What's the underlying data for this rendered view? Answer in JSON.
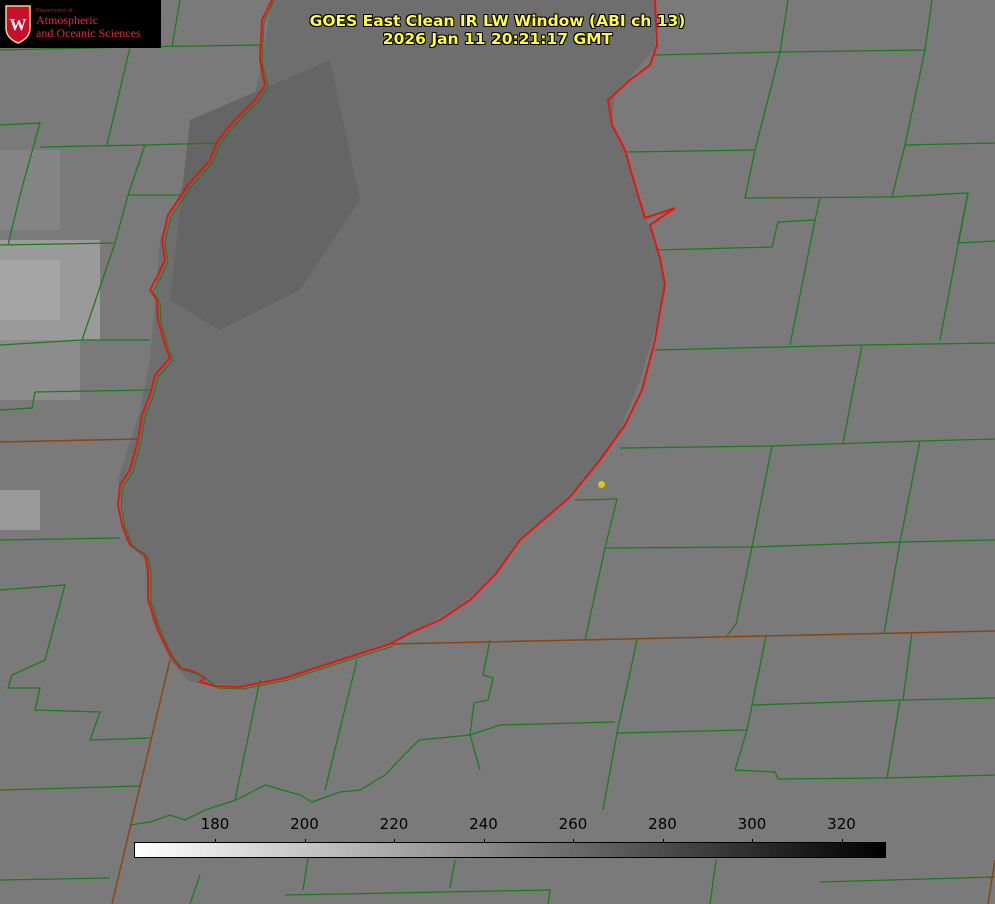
{
  "logo": {
    "department": "Department of",
    "line1": "Atmospheric",
    "line2": "and Oceanic Sciences",
    "crest_letter": "W"
  },
  "title": {
    "line1": "GOES East Clean IR LW Window (ABI ch 13)",
    "line2": "2026 Jan 11 20:21:17 GMT"
  },
  "colorbar": {
    "ticks": [
      "180",
      "200",
      "220",
      "240",
      "260",
      "280",
      "300",
      "320"
    ],
    "gradient_start": "#ffffff",
    "gradient_end": "#000000"
  },
  "colors": {
    "county_lines": "#1e7a1e",
    "state_lines": "#8b4513",
    "lake_shoreline": "#e8150f",
    "title_text": "#ffff3c",
    "marker": "#d9c41a"
  }
}
